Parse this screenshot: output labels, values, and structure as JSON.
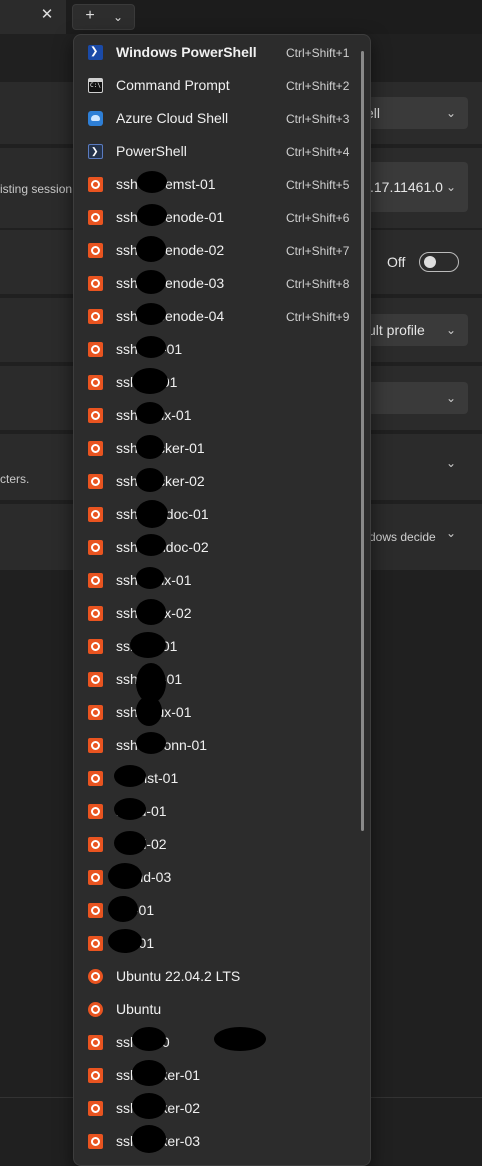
{
  "tabbar": {
    "close_glyph": "✕",
    "plus_glyph": "+",
    "dropdown_glyph": "⌄"
  },
  "settings": {
    "default_profile_value": "ell",
    "version_value": ".17.11461.0",
    "session_desc": "isting session,",
    "toggle_label": "Off",
    "new_instance_value": "ult profile",
    "chars_desc": "cters.",
    "windows_decide_value": "dows decide",
    "chevron_glyph": "⌄"
  },
  "menu": {
    "items": [
      {
        "label": "Windows PowerShell",
        "shortcut": "Ctrl+Shift+1",
        "icon": "powershell-icon"
      },
      {
        "label": "Command Prompt",
        "shortcut": "Ctrl+Shift+2",
        "icon": "command-prompt-icon"
      },
      {
        "label": "Azure Cloud Shell",
        "shortcut": "Ctrl+Shift+3",
        "icon": "azure-cloud-shell-icon"
      },
      {
        "label": "PowerShell",
        "shortcut": "Ctrl+Shift+4",
        "icon": "powershell-core-icon"
      },
      {
        "label": "ssh-kubemst-01",
        "shortcut": "Ctrl+Shift+5",
        "icon": "ubuntu-icon"
      },
      {
        "label": "ssh-kubenode-01",
        "shortcut": "Ctrl+Shift+6",
        "icon": "ubuntu-icon"
      },
      {
        "label": "ssh-kubenode-02",
        "shortcut": "Ctrl+Shift+7",
        "icon": "ubuntu-icon"
      },
      {
        "label": "ssh-kubenode-03",
        "shortcut": "Ctrl+Shift+8",
        "icon": "ubuntu-icon"
      },
      {
        "label": "ssh-kubenode-04",
        "shortcut": "Ctrl+Shift+9",
        "icon": "ubuntu-icon"
      },
      {
        "label": "ssh-apt-01",
        "shortcut": "",
        "icon": "ubuntu-icon"
      },
      {
        "label": "ssl-apt-01",
        "shortcut": "",
        "icon": "ubuntu-icon"
      },
      {
        "label": "ssh-linux-01",
        "shortcut": "",
        "icon": "ubuntu-icon"
      },
      {
        "label": "ssh-docker-01",
        "shortcut": "",
        "icon": "ubuntu-icon"
      },
      {
        "label": "ssh-docker-02",
        "shortcut": "",
        "icon": "ubuntu-icon"
      },
      {
        "label": "ssh-ubudoc-01",
        "shortcut": "",
        "icon": "ubuntu-icon"
      },
      {
        "label": "ssh-ubudoc-02",
        "shortcut": "",
        "icon": "ubuntu-icon"
      },
      {
        "label": "ssh-linux-01",
        "shortcut": "",
        "icon": "ubuntu-icon"
      },
      {
        "label": "ssh-linux-02",
        "shortcut": "",
        "icon": "ubuntu-icon"
      },
      {
        "label": "ssl-nta-01",
        "shortcut": "",
        "icon": "ubuntu-icon"
      },
      {
        "label": "ssh-nta-01",
        "shortcut": "",
        "icon": "ubuntu-icon"
      },
      {
        "label": "ssh-linux-01",
        "shortcut": "",
        "icon": "ubuntu-icon"
      },
      {
        "label": "ssh-csconn-01",
        "shortcut": "",
        "icon": "ubuntu-icon"
      },
      {
        "label": "-k8mst-01",
        "shortcut": "",
        "icon": "ubuntu-icon"
      },
      {
        "label": "k8nd-01",
        "shortcut": "",
        "icon": "ubuntu-icon"
      },
      {
        "label": "k8nd-02",
        "shortcut": "",
        "icon": "ubuntu-icon"
      },
      {
        "label": "-k8nd-03",
        "shortcut": "",
        "icon": "ubuntu-icon"
      },
      {
        "label": "oic-01",
        "shortcut": "",
        "icon": "ubuntu-icon"
      },
      {
        "label": "elk-01",
        "shortcut": "",
        "icon": "ubuntu-icon"
      },
      {
        "label": "Ubuntu 22.04.2 LTS",
        "shortcut": "",
        "icon": "ubuntu-circle-icon"
      },
      {
        "label": "Ubuntu",
        "shortcut": "",
        "icon": "ubuntu-circle-icon"
      },
      {
        "label": "ssl-apt-0",
        "shortcut": "",
        "icon": "ubuntu-icon"
      },
      {
        "label": "ssl-docker-01",
        "shortcut": "",
        "icon": "ubuntu-icon"
      },
      {
        "label": "ssl-docker-02",
        "shortcut": "",
        "icon": "ubuntu-icon"
      },
      {
        "label": "ssl-docker-03",
        "shortcut": "",
        "icon": "ubuntu-icon"
      }
    ]
  }
}
